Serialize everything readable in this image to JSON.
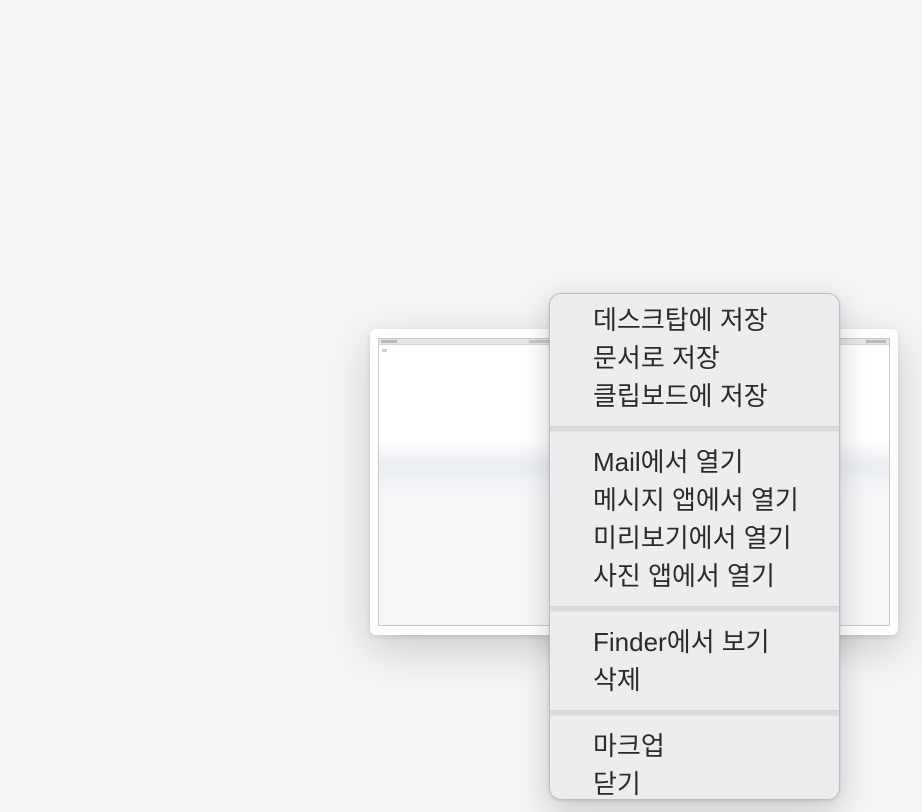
{
  "menu": {
    "groups": [
      {
        "items": [
          "데스크탑에 저장",
          "문서로 저장",
          "클립보드에 저장"
        ]
      },
      {
        "items": [
          "Mail에서 열기",
          "메시지 앱에서 열기",
          "미리보기에서 열기",
          "사진 앱에서 열기"
        ]
      },
      {
        "items": [
          "Finder에서 보기",
          "삭제"
        ]
      },
      {
        "items": [
          "마크업",
          "닫기"
        ]
      }
    ]
  }
}
